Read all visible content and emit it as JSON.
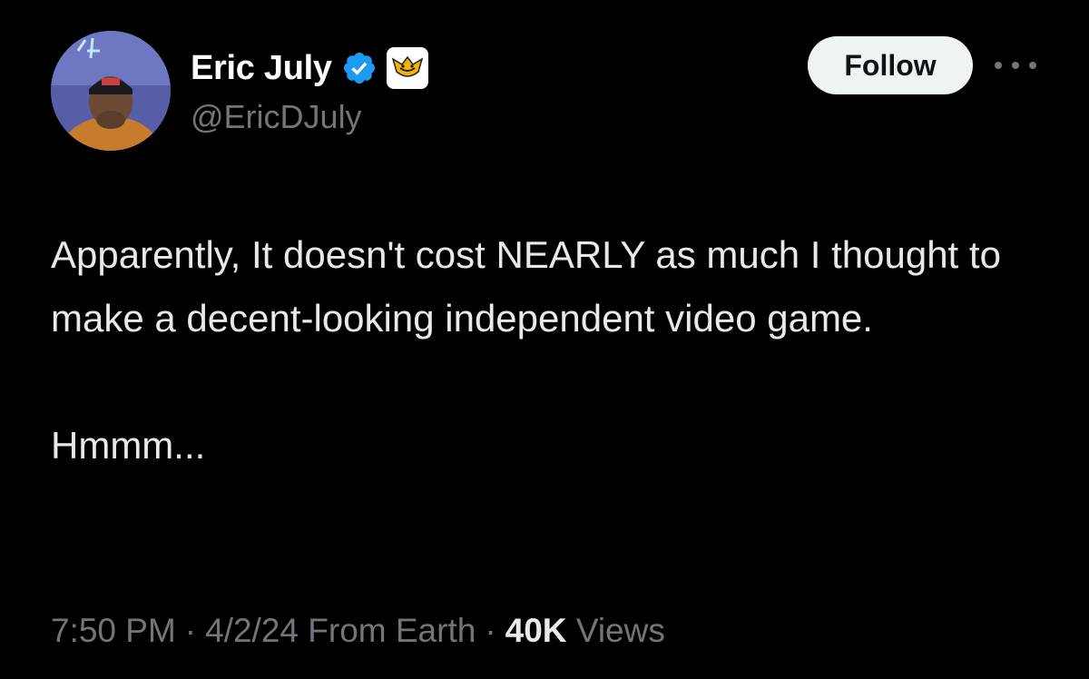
{
  "author": {
    "display_name": "Eric July",
    "handle": "@EricDJuly",
    "verified_icon": "verified-badge-icon",
    "affiliate_icon": "affiliate-badge-icon",
    "verified_color": "#1d9bf0"
  },
  "actions": {
    "follow_label": "Follow",
    "more_icon": "more-horizontal-icon"
  },
  "tweet": {
    "paragraphs": [
      "Apparently, It doesn't cost NEARLY as much I thought to make a decent-looking independent video game.",
      "Hmmm..."
    ]
  },
  "meta": {
    "time": "7:50 PM",
    "separator": "·",
    "date_source": "4/2/24 From Earth",
    "views_count": "40K",
    "views_label": "Views"
  },
  "colors": {
    "background": "#000000",
    "text_primary": "#e7e9ea",
    "text_secondary": "#71767b",
    "button_bg": "#eff3f4"
  }
}
